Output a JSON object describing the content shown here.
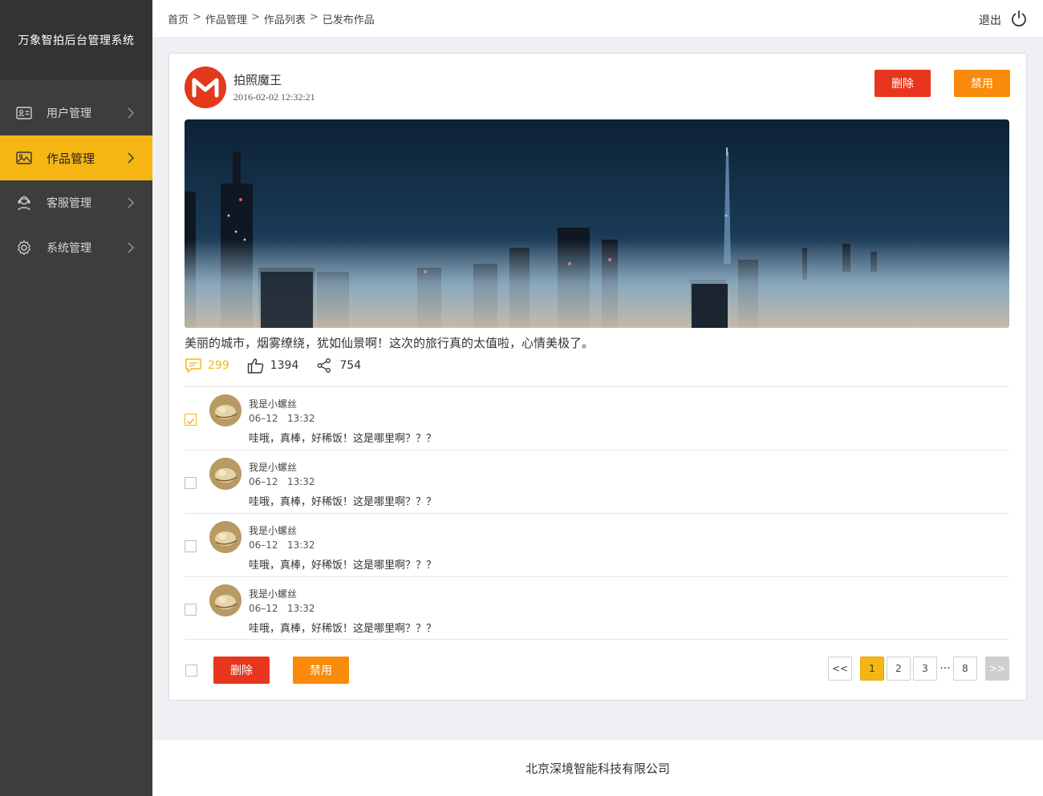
{
  "app": {
    "title": "万象智拍后台管理系统"
  },
  "sidebar": {
    "items": [
      {
        "label": "用户管理",
        "icon": "id-card-icon",
        "active": false
      },
      {
        "label": "作品管理",
        "icon": "image-icon",
        "active": true
      },
      {
        "label": "客服管理",
        "icon": "headset-icon",
        "active": false
      },
      {
        "label": "系统管理",
        "icon": "gear-icon",
        "active": false
      }
    ]
  },
  "header": {
    "breadcrumb": [
      "首页",
      "作品管理",
      "作品列表",
      "已发布作品"
    ],
    "separator": ">",
    "logout_label": "退出"
  },
  "post": {
    "author": "拍照魔王",
    "time": "2016-02-02  12:32:21",
    "delete_label": "删除",
    "disable_label": "禁用",
    "caption": "美丽的城市，烟雾缭绕，犹如仙景啊！这次的旅行真的太值啦，心情美极了。",
    "comment_count": "299",
    "like_count": "1394",
    "share_count": "754"
  },
  "comments": [
    {
      "name": "我是小螺丝",
      "time": "06–12   13:32",
      "text": "哇哦，真棒，好稀饭！这是哪里啊？？？",
      "checked": true
    },
    {
      "name": "我是小螺丝",
      "time": "06–12   13:32",
      "text": "哇哦，真棒，好稀饭！这是哪里啊？？？",
      "checked": false
    },
    {
      "name": "我是小螺丝",
      "time": "06–12   13:32",
      "text": "哇哦，真棒，好稀饭！这是哪里啊？？？",
      "checked": false
    },
    {
      "name": "我是小螺丝",
      "time": "06–12   13:32",
      "text": "哇哦，真棒，好稀饭！这是哪里啊？？？",
      "checked": false
    }
  ],
  "bulk": {
    "delete_label": "删除",
    "disable_label": "禁用"
  },
  "pager": {
    "prev": "<<",
    "pages": [
      "1",
      "2",
      "3"
    ],
    "ellipsis": "···",
    "last": "8",
    "next": ">>",
    "current": "1"
  },
  "footer": {
    "company": "北京深境智能科技有限公司"
  },
  "colors": {
    "accent": "#f5b614",
    "danger": "#e8361e",
    "warning": "#f98a0a",
    "sidebar": "#3d3d3d"
  }
}
